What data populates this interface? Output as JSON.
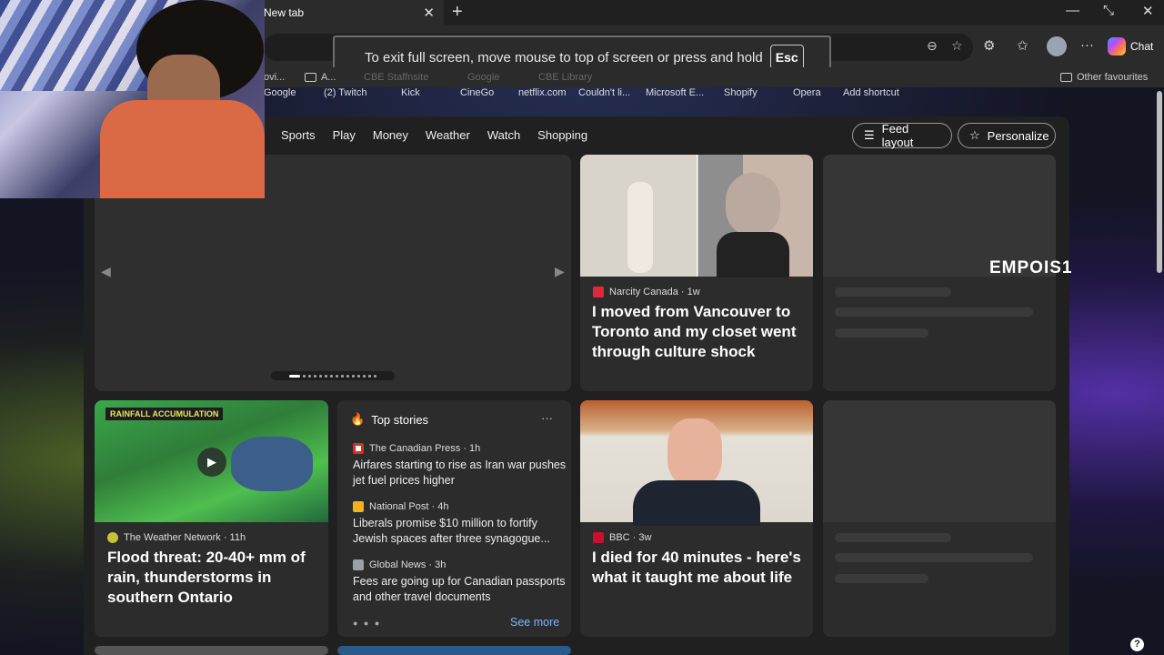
{
  "browser": {
    "tab_title": "New tab",
    "tab_close": "✕",
    "new_tab": "+",
    "window_minimize": "—",
    "window_restore": "⤡",
    "window_close": "✕",
    "chat_label": "Chat"
  },
  "fullscreen_toast": {
    "message": "To exit full screen, move mouse to top of screen or press and hold",
    "key": "Esc"
  },
  "favorites": {
    "items": [
      "ovi...",
      "A...",
      "CBE Staffnsite",
      "Google",
      "CBE Library"
    ],
    "other": "Other favourites"
  },
  "quick_links": [
    "Google",
    "(2) Twitch",
    "Kick",
    "CineGo",
    "netflix.com",
    "Couldn't li...",
    "Microsoft E...",
    "Shopify",
    "Opera",
    "Add shortcut"
  ],
  "feed_nav": {
    "items": [
      "Sports",
      "Play",
      "Money",
      "Weather",
      "Watch",
      "Shopping"
    ],
    "feed_layout": "Feed layout",
    "personalize": "Personalize"
  },
  "cards": {
    "narcity": {
      "source": "Narcity Canada · 1w",
      "headline": "I moved from Vancouver to Toronto and my closet went through culture shock"
    },
    "weather": {
      "source": "The Weather Network · 11h",
      "headline": "Flood threat: 20-40+ mm of rain, thunderstorms in southern Ontario",
      "map_label": "RAINFALL ACCUMULATION"
    },
    "top_stories": {
      "title": "Top stories",
      "more": "···",
      "items": [
        {
          "source": "The Canadian Press · 1h",
          "title": "Airfares starting to rise as Iran war pushes jet fuel prices higher"
        },
        {
          "source": "National Post · 4h",
          "title": "Liberals promise $10 million to fortify Jewish spaces after three synagogue..."
        },
        {
          "source": "Global News · 3h",
          "title": "Fees are going up for Canadian passports and other travel documents"
        }
      ],
      "see_more": "See more"
    },
    "bbc": {
      "source": "BBC · 3w",
      "headline": "I died for 40 minutes - here's what it taught me about life"
    }
  },
  "watermark": "EMPOIS1",
  "help": "?",
  "colors": {
    "narcity_logo": "#e3263c",
    "weather_logo": "#c8c23a",
    "bbc_logo": "#c8102e",
    "cp_logo": "#e02a2a",
    "np_logo": "#f2b21c",
    "global_logo": "#9aa0a6",
    "fire_icon": "#ff7a2a",
    "see_more": "#7ab7ff"
  }
}
